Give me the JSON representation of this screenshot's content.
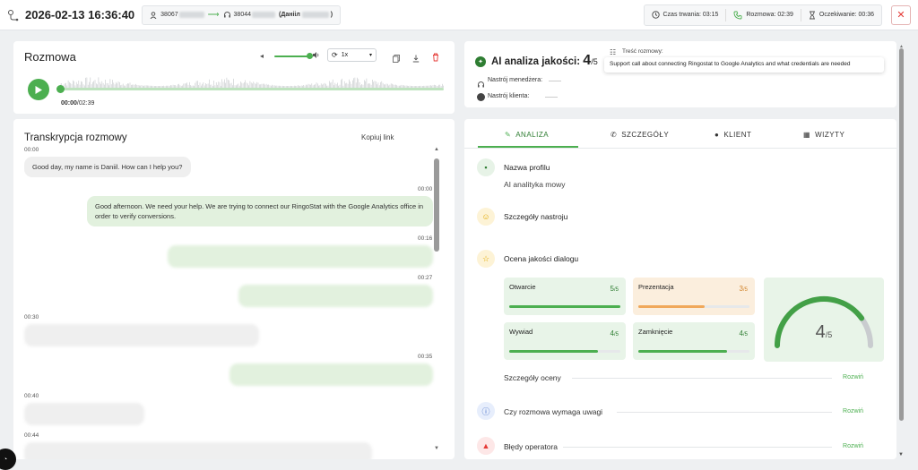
{
  "header": {
    "datetime": "2026-02-13 16:36:40",
    "caller_number": "38067",
    "callee_number": "38044",
    "callee_name": "(Данііл",
    "callee_suffix": ")",
    "duration": "Czas trwania: 03:15",
    "talk": "Rozmowa: 02:39",
    "wait": "Oczekiwanie: 00:36"
  },
  "player": {
    "title": "Rozmowa",
    "speed": "1x",
    "time": "00:00",
    "total": "/02:39",
    "volume_percent": 92,
    "progress_percent": 0
  },
  "transcript": {
    "title": "Transkrypcja rozmowy",
    "copy_link": "Kopiuj link",
    "messages": [
      {
        "ts": "00:00",
        "text": "Good day, my name is Daniil. How can I help you?"
      },
      {
        "ts": "00:00",
        "text": "Good afternoon. We need your help. We are trying to connect our RingoStat with the Google Analytics office in order to verify conversions."
      },
      {
        "ts": "00:16",
        "text": ""
      },
      {
        "ts": "00:27",
        "text": ""
      },
      {
        "ts": "00:30",
        "text": ""
      },
      {
        "ts": "00:35",
        "text": ""
      },
      {
        "ts": "00:40",
        "text": ""
      },
      {
        "ts": "00:44",
        "text": ""
      }
    ]
  },
  "ai": {
    "label": "AI analiza jakości:",
    "score": "4",
    "outof": "/5",
    "manager_mood": "Nastrój menedżera:",
    "client_mood": "Nastrój klienta:",
    "content_label": "Treść rozmowy:",
    "content_text": "Support call about connecting Ringostat to Google Analytics and what credentials are needed"
  },
  "tabs": [
    {
      "label": "ANALIZA",
      "icon": "magic-wand-icon"
    },
    {
      "label": "SZCZEGÓŁY",
      "icon": "phone-icon"
    },
    {
      "label": "KLIENT",
      "icon": "person-icon"
    },
    {
      "label": "WIZYTY",
      "icon": "calendar-icon"
    }
  ],
  "analysis": {
    "profile_title": "Nazwa profilu",
    "profile_value": "AI analityka mowy",
    "mood_details": "Szczegóły nastroju",
    "dialog_quality": "Ocena jakości dialogu",
    "cards": [
      {
        "label": "Otwarcie",
        "score": "5",
        "outof": "/5",
        "fill": 1.0,
        "color": "#4caf50",
        "bg": "#e8f4e8",
        "score_color": "#2e7d32"
      },
      {
        "label": "Prezentacja",
        "score": "3",
        "outof": "/5",
        "fill": 0.6,
        "color": "#f0a85a",
        "bg": "#fbeedd",
        "score_color": "#d2862e"
      },
      {
        "label": "Wywiad",
        "score": "4",
        "outof": "/5",
        "fill": 0.8,
        "color": "#4caf50",
        "bg": "#e8f4e8",
        "score_color": "#2e7d32"
      },
      {
        "label": "Zamknięcie",
        "score": "4",
        "outof": "/5",
        "fill": 0.8,
        "color": "#4caf50",
        "bg": "#e8f4e8",
        "score_color": "#2e7d32"
      }
    ],
    "gauge_score": "4",
    "gauge_outof": "/5",
    "gauge_fraction": 0.8,
    "details": "Szczegóły oceny",
    "attention": "Czy rozmowa wymaga uwagi",
    "errors": "Błędy operatora",
    "expand": "Rozwiń"
  },
  "colors": {
    "accent": "#4caf50",
    "danger": "#e53935"
  }
}
